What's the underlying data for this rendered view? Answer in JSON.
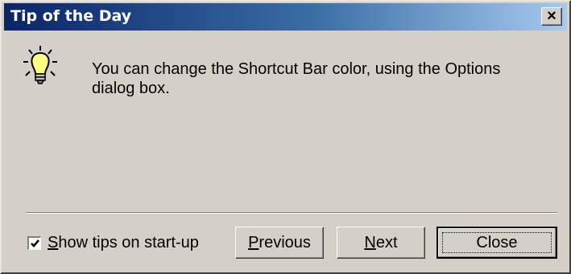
{
  "window": {
    "title": "Tip of the Day",
    "close_glyph": "×"
  },
  "tip": {
    "icon": "lightbulb-icon",
    "text": "You can change the Shortcut Bar color, using the Options dialog box."
  },
  "show_tips": {
    "checked": true,
    "label_accel": "S",
    "label_rest": "how tips on start-up"
  },
  "buttons": {
    "previous": {
      "accel": "P",
      "rest": "revious"
    },
    "next": {
      "accel": "N",
      "rest": "ext"
    },
    "close": {
      "label": "Close"
    }
  },
  "colors": {
    "titlebar_start": "#0a246a",
    "titlebar_end": "#a6caf0",
    "face": "#d4d0c8"
  }
}
